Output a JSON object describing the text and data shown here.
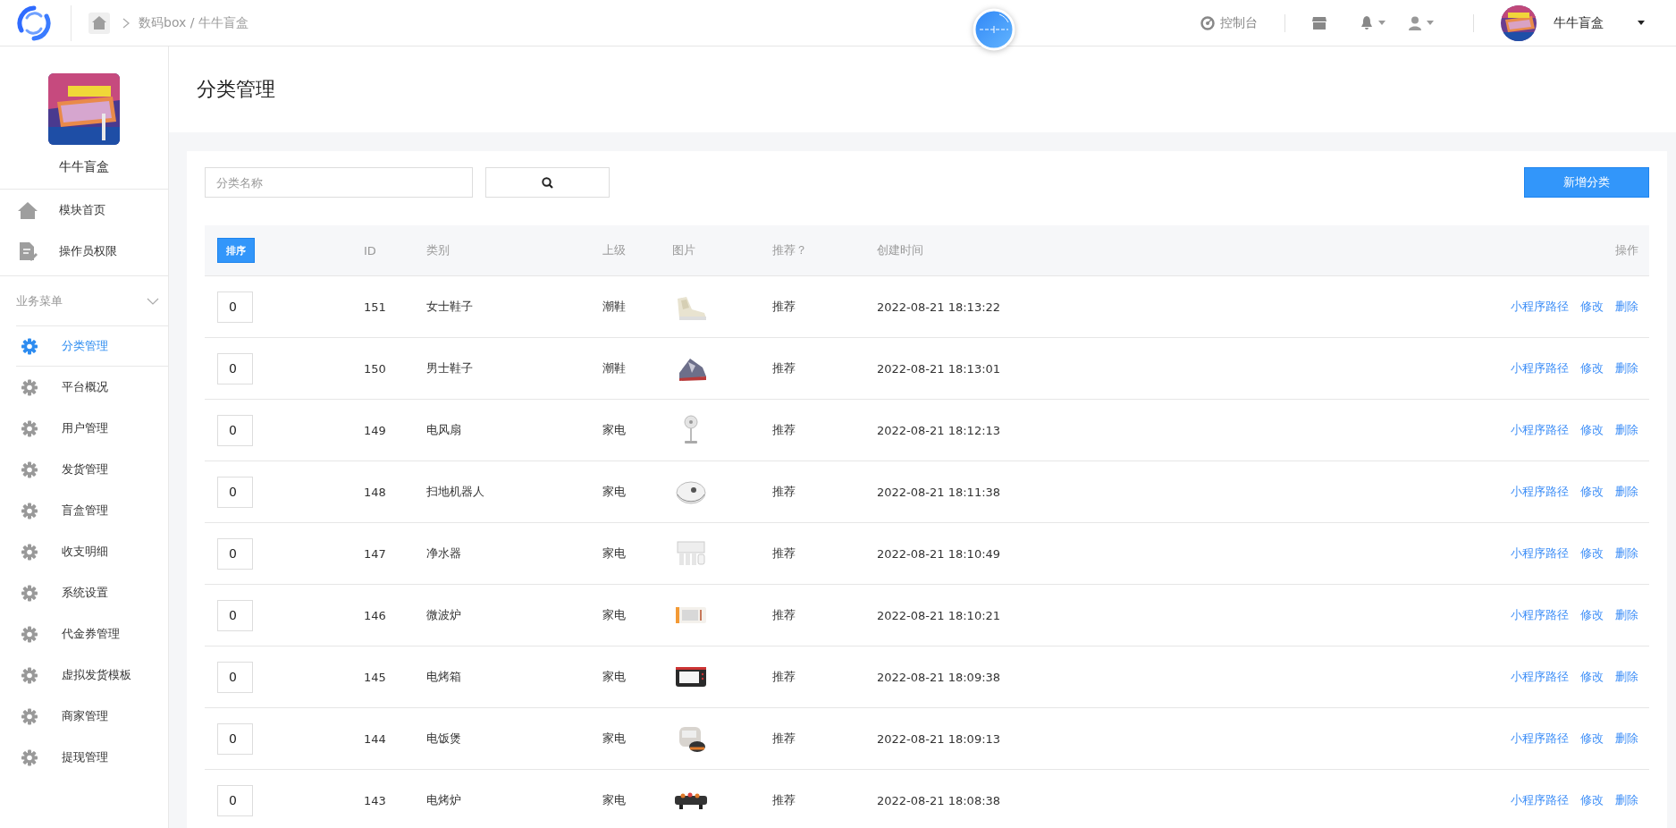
{
  "topbar": {
    "breadcrumb": "数码box / 牛牛盲盒",
    "console": "控制台",
    "user_name": "牛牛盲盒"
  },
  "sidebar": {
    "profile_name": "牛牛盲盒",
    "top_items": [
      {
        "label": "模块首页",
        "kind": "home",
        "selected": false
      },
      {
        "label": "操作员权限",
        "kind": "doc",
        "selected": false
      }
    ],
    "section": {
      "title": "业务菜单",
      "expanded": true,
      "items": [
        {
          "label": "分类管理",
          "selected": true
        },
        {
          "label": "平台概况",
          "selected": false
        },
        {
          "label": "用户管理",
          "selected": false
        },
        {
          "label": "发货管理",
          "selected": false
        },
        {
          "label": "盲盒管理",
          "selected": false
        },
        {
          "label": "收支明细",
          "selected": false
        },
        {
          "label": "系统设置",
          "selected": false
        },
        {
          "label": "代金券管理",
          "selected": false
        },
        {
          "label": "虚拟发货模板",
          "selected": false
        },
        {
          "label": "商家管理",
          "selected": false
        },
        {
          "label": "提现管理",
          "selected": false
        }
      ]
    }
  },
  "page_title": "分类管理",
  "search": {
    "placeholder": "分类名称"
  },
  "add_button": "新增分类",
  "table": {
    "columns": [
      "排序",
      "ID",
      "类别",
      "上级",
      "图片",
      "推荐？",
      "创建时间",
      "操作"
    ],
    "rows": [
      {
        "sort": "0",
        "id": "151",
        "name": "女士鞋子",
        "parent": "潮鞋",
        "recommend": "推荐",
        "created": "2022-08-21 18:13:22",
        "actions": [
          "小程序路径",
          "修改",
          "删除"
        ]
      },
      {
        "sort": "0",
        "id": "150",
        "name": "男士鞋子",
        "parent": "潮鞋",
        "recommend": "推荐",
        "created": "2022-08-21 18:13:01",
        "actions": [
          "小程序路径",
          "修改",
          "删除"
        ]
      },
      {
        "sort": "0",
        "id": "149",
        "name": "电风扇",
        "parent": "家电",
        "recommend": "推荐",
        "created": "2022-08-21 18:12:13",
        "actions": [
          "小程序路径",
          "修改",
          "删除"
        ]
      },
      {
        "sort": "0",
        "id": "148",
        "name": "扫地机器人",
        "parent": "家电",
        "recommend": "推荐",
        "created": "2022-08-21 18:11:38",
        "actions": [
          "小程序路径",
          "修改",
          "删除"
        ]
      },
      {
        "sort": "0",
        "id": "147",
        "name": "净水器",
        "parent": "家电",
        "recommend": "推荐",
        "created": "2022-08-21 18:10:49",
        "actions": [
          "小程序路径",
          "修改",
          "删除"
        ]
      },
      {
        "sort": "0",
        "id": "146",
        "name": "微波炉",
        "parent": "家电",
        "recommend": "推荐",
        "created": "2022-08-21 18:10:21",
        "actions": [
          "小程序路径",
          "修改",
          "删除"
        ]
      },
      {
        "sort": "0",
        "id": "145",
        "name": "电烤箱",
        "parent": "家电",
        "recommend": "推荐",
        "created": "2022-08-21 18:09:38",
        "actions": [
          "小程序路径",
          "修改",
          "删除"
        ]
      },
      {
        "sort": "0",
        "id": "144",
        "name": "电饭煲",
        "parent": "家电",
        "recommend": "推荐",
        "created": "2022-08-21 18:09:13",
        "actions": [
          "小程序路径",
          "修改",
          "删除"
        ]
      },
      {
        "sort": "0",
        "id": "143",
        "name": "电烤炉",
        "parent": "家电",
        "recommend": "推荐",
        "created": "2022-08-21 18:08:38",
        "actions": [
          "小程序路径",
          "修改",
          "删除"
        ]
      }
    ]
  }
}
